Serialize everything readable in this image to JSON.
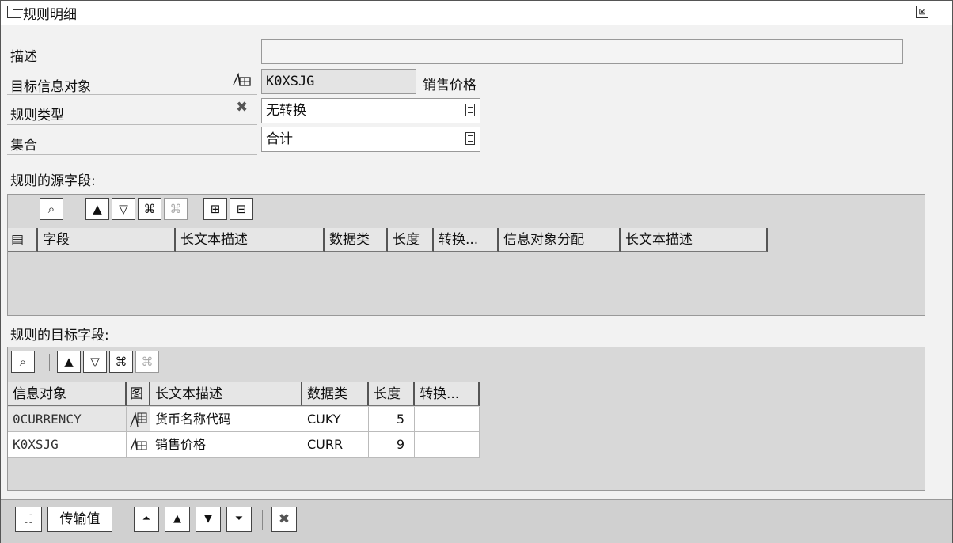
{
  "window": {
    "title": "规则明细",
    "close_glyph": "⊠"
  },
  "form": {
    "description": {
      "label": "描述",
      "value": ""
    },
    "target_infoobject": {
      "label": "目标信息对象",
      "value": "K0XSJG",
      "text": "销售价格"
    },
    "rule_type": {
      "label": "规则类型",
      "value": "无转换"
    },
    "aggregation": {
      "label": "集合",
      "value": "合计"
    }
  },
  "source_section": {
    "title": "规则的源字段:",
    "columns": [
      "字段",
      "长文本描述",
      "数据类",
      "长度",
      "转换...",
      "信息对象分配",
      "长文本描述"
    ],
    "rows": []
  },
  "target_section": {
    "title": "规则的目标字段:",
    "columns": [
      "信息对象",
      "图",
      "长文本描述",
      "数据类",
      "长度",
      "转换..."
    ],
    "rows": [
      {
        "infoobject": "0CURRENCY",
        "desc": "货币名称代码",
        "dtype": "CUKY",
        "length": "5",
        "conv": ""
      },
      {
        "infoobject": "K0XSJG",
        "desc": "销售价格",
        "dtype": "CURR",
        "length": "9",
        "conv": ""
      }
    ]
  },
  "footer": {
    "transfer_label": "传输值"
  }
}
